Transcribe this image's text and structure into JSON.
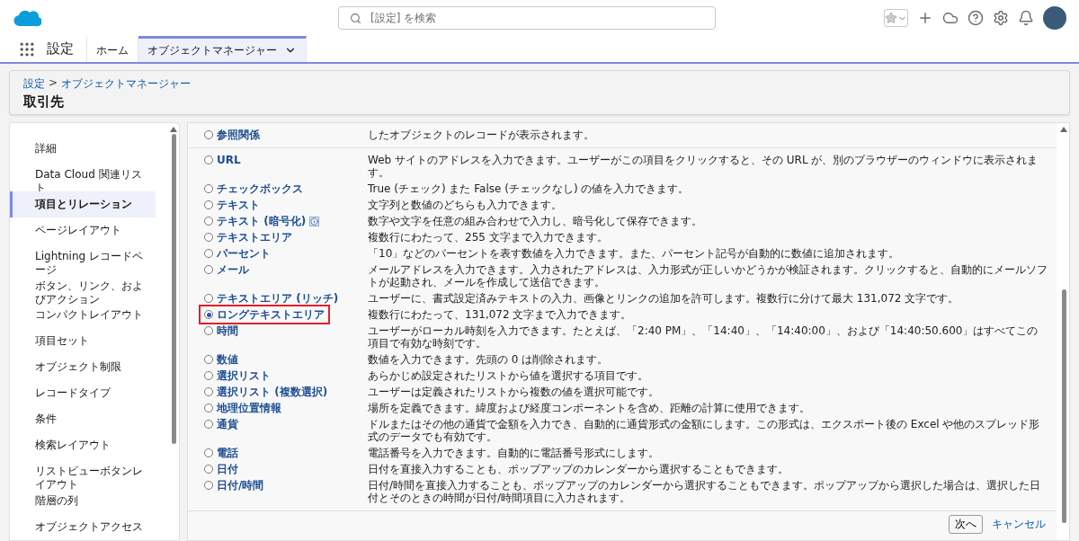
{
  "top_bar": {
    "search": {
      "placeholder": "[設定] を検索"
    }
  },
  "nav": {
    "app_name": "設定",
    "tabs": [
      {
        "label": "ホーム",
        "selected": false,
        "dropdown": false
      },
      {
        "label": "オブジェクトマネージャー",
        "selected": true,
        "dropdown": true
      }
    ]
  },
  "page_header": {
    "breadcrumb": [
      "設定",
      "オブジェクトマネージャー"
    ],
    "separator": ">",
    "title": "取引先"
  },
  "sidebar": {
    "items": [
      {
        "label": "詳細",
        "selected": false
      },
      {
        "label": "Data Cloud 関連リスト",
        "selected": false
      },
      {
        "label": "項目とリレーション",
        "selected": true
      },
      {
        "label": "ページレイアウト",
        "selected": false
      },
      {
        "label": "Lightning レコードページ",
        "selected": false
      },
      {
        "label": "ボタン、リンク、およびアクション",
        "selected": false
      },
      {
        "label": "コンパクトレイアウト",
        "selected": false
      },
      {
        "label": "項目セット",
        "selected": false
      },
      {
        "label": "オブジェクト制限",
        "selected": false
      },
      {
        "label": "レコードタイプ",
        "selected": false
      },
      {
        "label": "条件",
        "selected": false
      },
      {
        "label": "検索レイアウト",
        "selected": false
      },
      {
        "label": "リストビューボタンレイアウト",
        "selected": false
      },
      {
        "label": "階層の列",
        "selected": false
      },
      {
        "label": "オブジェクトアクセス",
        "selected": false
      }
    ]
  },
  "sections": [
    {
      "fields": [
        {
          "label": "参照関係",
          "description": "したオブジェクトのレコードが表示されます。",
          "selected": false,
          "highlighted": false,
          "info": false
        }
      ]
    },
    {
      "fields": [
        {
          "label": "URL",
          "description": "Web サイトのアドレスを入力できます。ユーザーがこの項目をクリックすると、その URL が、別のブラウザーのウィンドウに表示されます。",
          "selected": false,
          "highlighted": false,
          "info": false
        },
        {
          "label": "チェックボックス",
          "description": "True (チェック) また False (チェックなし) の値を入力できます。",
          "selected": false,
          "highlighted": false,
          "info": false
        },
        {
          "label": "テキスト",
          "description": "文字列と数値のどちらも入力できます。",
          "selected": false,
          "highlighted": false,
          "info": false
        },
        {
          "label": "テキスト (暗号化)",
          "description": "数字や文字を任意の組み合わせで入力し、暗号化して保存できます。",
          "selected": false,
          "highlighted": false,
          "info": true
        },
        {
          "label": "テキストエリア",
          "description": "複数行にわたって、255 文字まで入力できます。",
          "selected": false,
          "highlighted": false,
          "info": false
        },
        {
          "label": "パーセント",
          "description": "「10」などのパーセントを表す数値を入力できます。また、パーセント記号が自動的に数値に追加されます。",
          "selected": false,
          "highlighted": false,
          "info": false
        },
        {
          "label": "メール",
          "description": "メールアドレスを入力できます。入力されたアドレスは、入力形式が正しいかどうかが検証されます。クリックすると、自動的にメールソフトが起動され、メールを作成して送信できます。",
          "selected": false,
          "highlighted": false,
          "info": false
        },
        {
          "label": "テキストエリア (リッチ)",
          "description": "ユーザーに、書式設定済みテキストの入力、画像とリンクの追加を許可します。複数行に分けて最大 131,072 文字です。",
          "selected": false,
          "highlighted": false,
          "info": false
        },
        {
          "label": "ロングテキストエリア",
          "description": "複数行にわたって、131,072 文字まで入力できます。",
          "selected": true,
          "highlighted": true,
          "info": false
        },
        {
          "label": "時間",
          "description": "ユーザーがローカル時刻を入力できます。たとえば、「2:40 PM」、「14:40」、「14:40:00」、および「14:40:50.600」はすべてこの項目で有効な時刻です。",
          "selected": false,
          "highlighted": false,
          "info": false
        },
        {
          "label": "数値",
          "description": "数値を入力できます。先頭の 0 は削除されます。",
          "selected": false,
          "highlighted": false,
          "info": false
        },
        {
          "label": "選択リスト",
          "description": "あらかじめ設定されたリストから値を選択する項目です。",
          "selected": false,
          "highlighted": false,
          "info": false
        },
        {
          "label": "選択リスト (複数選択)",
          "description": "ユーザーは定義されたリストから複数の値を選択可能です。",
          "selected": false,
          "highlighted": false,
          "info": false
        },
        {
          "label": "地理位置情報",
          "description": "場所を定義できます。緯度および経度コンポーネントを含め、距離の計算に使用できます。",
          "selected": false,
          "highlighted": false,
          "info": false
        },
        {
          "label": "通貨",
          "description": "ドルまたはその他の通貨で金額を入力でき、自動的に通貨形式の金額にします。この形式は、エクスポート後の Excel や他のスプレッド形式のデータでも有効です。",
          "selected": false,
          "highlighted": false,
          "info": false
        },
        {
          "label": "電話",
          "description": "電話番号を入力できます。自動的に電話番号形式にします。",
          "selected": false,
          "highlighted": false,
          "info": false
        },
        {
          "label": "日付",
          "description": "日付を直接入力することも、ポップアップのカレンダーから選択することもできます。",
          "selected": false,
          "highlighted": false,
          "info": false
        },
        {
          "label": "日付/時間",
          "description": "日付/時間を直接入力することも、ポップアップのカレンダーから選択することもできます。ポップアップから選択した場合は、選択した日付とそのときの時間が日付/時間項目に入力されます。",
          "selected": false,
          "highlighted": false,
          "info": false
        }
      ]
    }
  ],
  "footer": {
    "next": "次へ",
    "cancel": "キャンセル"
  }
}
